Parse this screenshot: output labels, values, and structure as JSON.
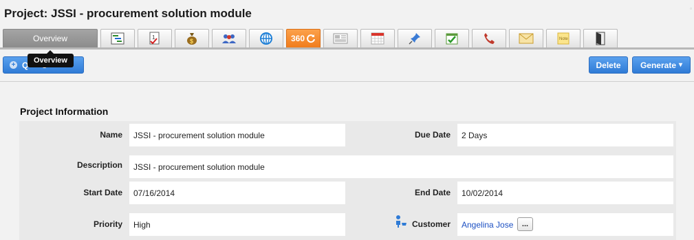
{
  "page": {
    "title": "Project: JSSI - procurement solution module"
  },
  "tabs": [
    {
      "name": "overview",
      "label": "Overview",
      "icon": "overview"
    },
    {
      "name": "gantt",
      "icon": "gantt-chart-icon"
    },
    {
      "name": "tasks",
      "icon": "task-list-icon"
    },
    {
      "name": "budget",
      "icon": "money-bag-icon"
    },
    {
      "name": "team",
      "icon": "people-icon"
    },
    {
      "name": "web",
      "icon": "globe-icon"
    },
    {
      "name": "view-360",
      "label": "360",
      "icon": "refresh-icon"
    },
    {
      "name": "news",
      "icon": "newspaper-icon"
    },
    {
      "name": "calendar",
      "icon": "calendar-icon"
    },
    {
      "name": "pin",
      "icon": "pushpin-icon"
    },
    {
      "name": "checklist",
      "icon": "check-calendar-icon"
    },
    {
      "name": "calls",
      "icon": "phone-icon"
    },
    {
      "name": "email",
      "icon": "envelope-icon"
    },
    {
      "name": "notes",
      "icon": "note-icon"
    },
    {
      "name": "documents",
      "icon": "door-exit-icon"
    }
  ],
  "tooltip": {
    "text": "Overview"
  },
  "toolbar": {
    "quick_actions_label": "Q      s",
    "delete_label": "Delete",
    "generate_label": "Generate",
    "generate_caret": "▾"
  },
  "section": {
    "title": "Project Information"
  },
  "fields": {
    "name": {
      "label": "Name",
      "value": "JSSI - procurement solution module"
    },
    "due_date": {
      "label": "Due Date",
      "value": "2 Days"
    },
    "description": {
      "label": "Description",
      "value": "JSSI - procurement solution module"
    },
    "start_date": {
      "label": "Start Date",
      "value": "07/16/2014"
    },
    "end_date": {
      "label": "End Date",
      "value": "10/02/2014"
    },
    "priority": {
      "label": "Priority",
      "value": "High"
    },
    "customer": {
      "label": "Customer",
      "value": "Angelina Jose",
      "more_label": "..."
    }
  },
  "colors": {
    "accent_blue": "#2f7bd6",
    "tab_360_orange": "#f07c1c",
    "link_blue": "#1b4fc2"
  }
}
